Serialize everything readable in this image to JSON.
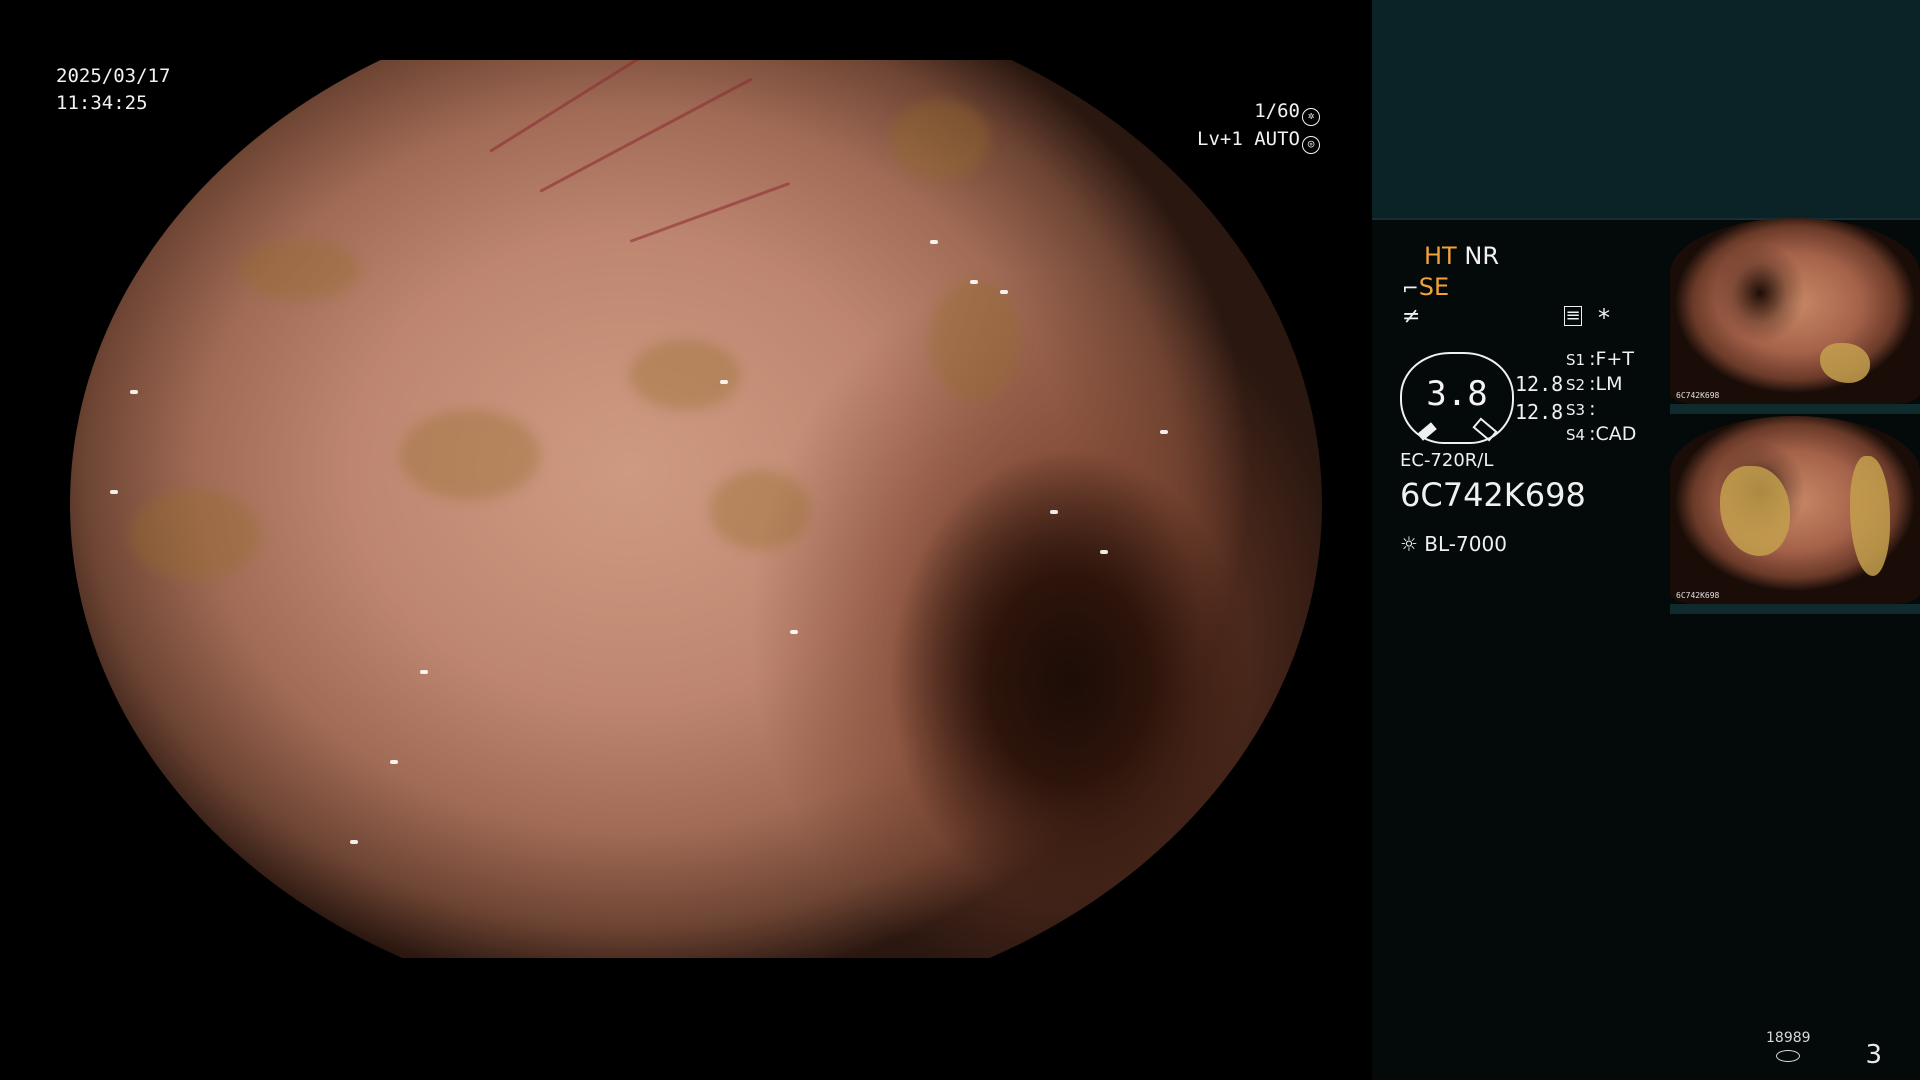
{
  "main_view": {
    "date": "2025/03/17",
    "time": "11:34:25",
    "shutter": "1/60",
    "shutter_icon": "aperture-icon",
    "level": "Lv+1",
    "mode": "AUTO",
    "mode_icon": "auto-iris-icon"
  },
  "panel": {
    "ht": "HT",
    "nr": "NR",
    "se": "SE",
    "se_icon": "structure-enhance-icon",
    "freeze_icon": "freeze-icon",
    "menu_icon": "settings-sheet-icon",
    "star": "*",
    "gauge_value": "3.8",
    "gauge_low": "12.8",
    "gauge_high": "12.8",
    "switches": [
      {
        "key": "S1",
        "value": "F+T"
      },
      {
        "key": "S2",
        "value": "LM"
      },
      {
        "key": "S3",
        "value": ""
      },
      {
        "key": "S4",
        "value": "CAD"
      }
    ],
    "scope_model": "EC-720R/L",
    "serial": "6C742K698",
    "light_source": "BL-7000",
    "light_icon": "light-source-icon"
  },
  "thumbnails": [
    {
      "caption": "6C742K698"
    },
    {
      "caption": "6C742K698"
    }
  ],
  "footer": {
    "storage_count": "18989",
    "storage_icon": "storage-icon",
    "page_number": "3"
  },
  "colors": {
    "accent_orange": "#f1a23a",
    "panel_top": "#0b2327",
    "panel_bg": "#04090a"
  }
}
